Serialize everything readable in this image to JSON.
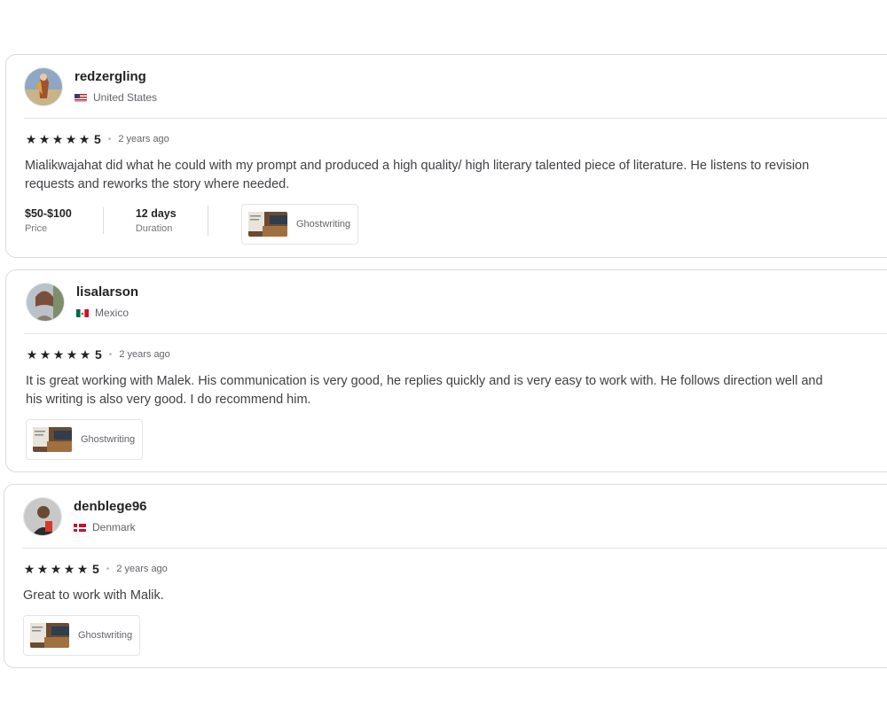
{
  "reviews": [
    {
      "username": "redzergling",
      "country": "United States",
      "rating": "5",
      "time": "2 years ago",
      "text_lines": [
        "Mialikwajahat did what he could with my prompt and produced a high quality/ high literary talented piece of literature. He listens to revision",
        "requests and reworks the story where needed."
      ],
      "price_value": "$50-$100",
      "price_label": "Price",
      "duration_value": "12 days",
      "duration_label": "Duration",
      "service": "Ghostwriting"
    },
    {
      "username": "lisalarson",
      "country": "Mexico",
      "rating": "5",
      "time": "2 years ago",
      "text_lines": [
        "It is great working with Malek. His communication is very good, he replies quickly and is very easy to work with. He follows direction well and",
        "his writing is also very good. I do recommend him."
      ],
      "service": "Ghostwriting"
    },
    {
      "username": "denblege96",
      "country": "Denmark",
      "rating": "5",
      "time": "2 years ago",
      "text_lines": [
        "Great to work with Malik."
      ],
      "service": "Ghostwriting"
    }
  ],
  "icons": {
    "star": "star-icon",
    "flag_us": "us-flag-icon",
    "flag_mx": "mexico-flag-icon",
    "flag_dk": "denmark-flag-icon"
  },
  "colors": {
    "border": "#dadbdd",
    "text": "#404145",
    "heading": "#222325",
    "muted": "#62646a"
  }
}
